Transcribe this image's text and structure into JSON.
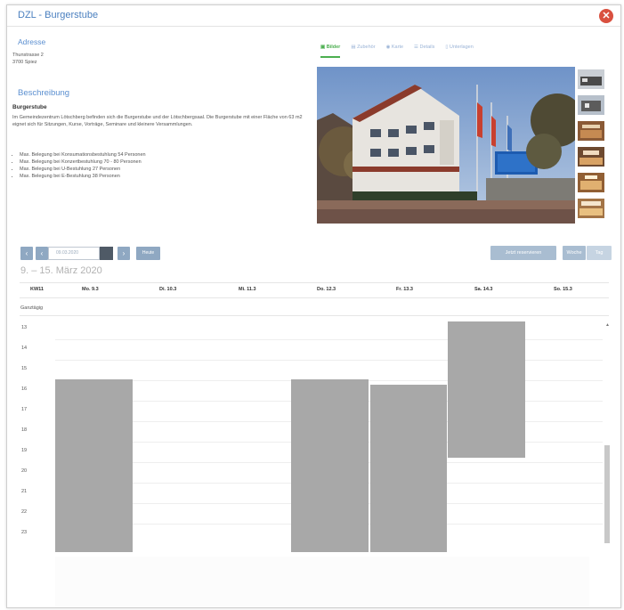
{
  "modal": {
    "title": "DZL - Burgerstube",
    "close_icon": "close-icon",
    "accent": "#d9503f"
  },
  "address": {
    "title": "Adresse",
    "lines": [
      "Thunstrasse 2",
      "3700 Spiez"
    ]
  },
  "description": {
    "title": "Beschreibung",
    "heading": "Burgerstube",
    "text": "Im Gemeindezentrum Lötschberg befinden sich die Burgerstube und der Lötschbergsaal. Die Burgerstube mit einer Fläche von 63 m2 eignet sich für Sitzungen, Kurse, Vorträge, Seminare und kleinere Versammlungen.",
    "bullets": [
      "Max. Belegung bei Konsumationsbestuhlung 54 Personen",
      "Max. Belegung bei Konzertbestuhlung 70 - 80 Personen",
      "Max. Belegung bei U-Bestuhlung 27 Personen",
      "Max. Belegung bei E-Bestuhlung 38 Personen"
    ]
  },
  "tabs": [
    {
      "label": "Bilder",
      "icon": "image-icon",
      "active": true
    },
    {
      "label": "Zubehör",
      "icon": "package-icon",
      "active": false
    },
    {
      "label": "Karte",
      "icon": "map-pin-icon",
      "active": false
    },
    {
      "label": "Details",
      "icon": "list-icon",
      "active": false
    },
    {
      "label": "Unterlagen",
      "icon": "document-icon",
      "active": false
    }
  ],
  "calendar_toolbar": {
    "date_value": "09.03.2020",
    "today_label": "Heute",
    "reserve_label": "Jetzt reservieren",
    "week_label": "Woche",
    "day_label": "Tag"
  },
  "calendar": {
    "range_title": "9. – 15. März 2020",
    "week_header": "KW11",
    "days": [
      "Mo. 9.3",
      "Di. 10.3",
      "Mi. 11.3",
      "Do. 12.3",
      "Fr. 13.3",
      "Sa. 14.3",
      "So. 15.3"
    ],
    "allday_label": "Ganztägig",
    "hours": [
      "13",
      "14",
      "15",
      "16",
      "17",
      "18",
      "19",
      "20",
      "21",
      "22",
      "23"
    ],
    "event_color": "#a8a8a8"
  }
}
